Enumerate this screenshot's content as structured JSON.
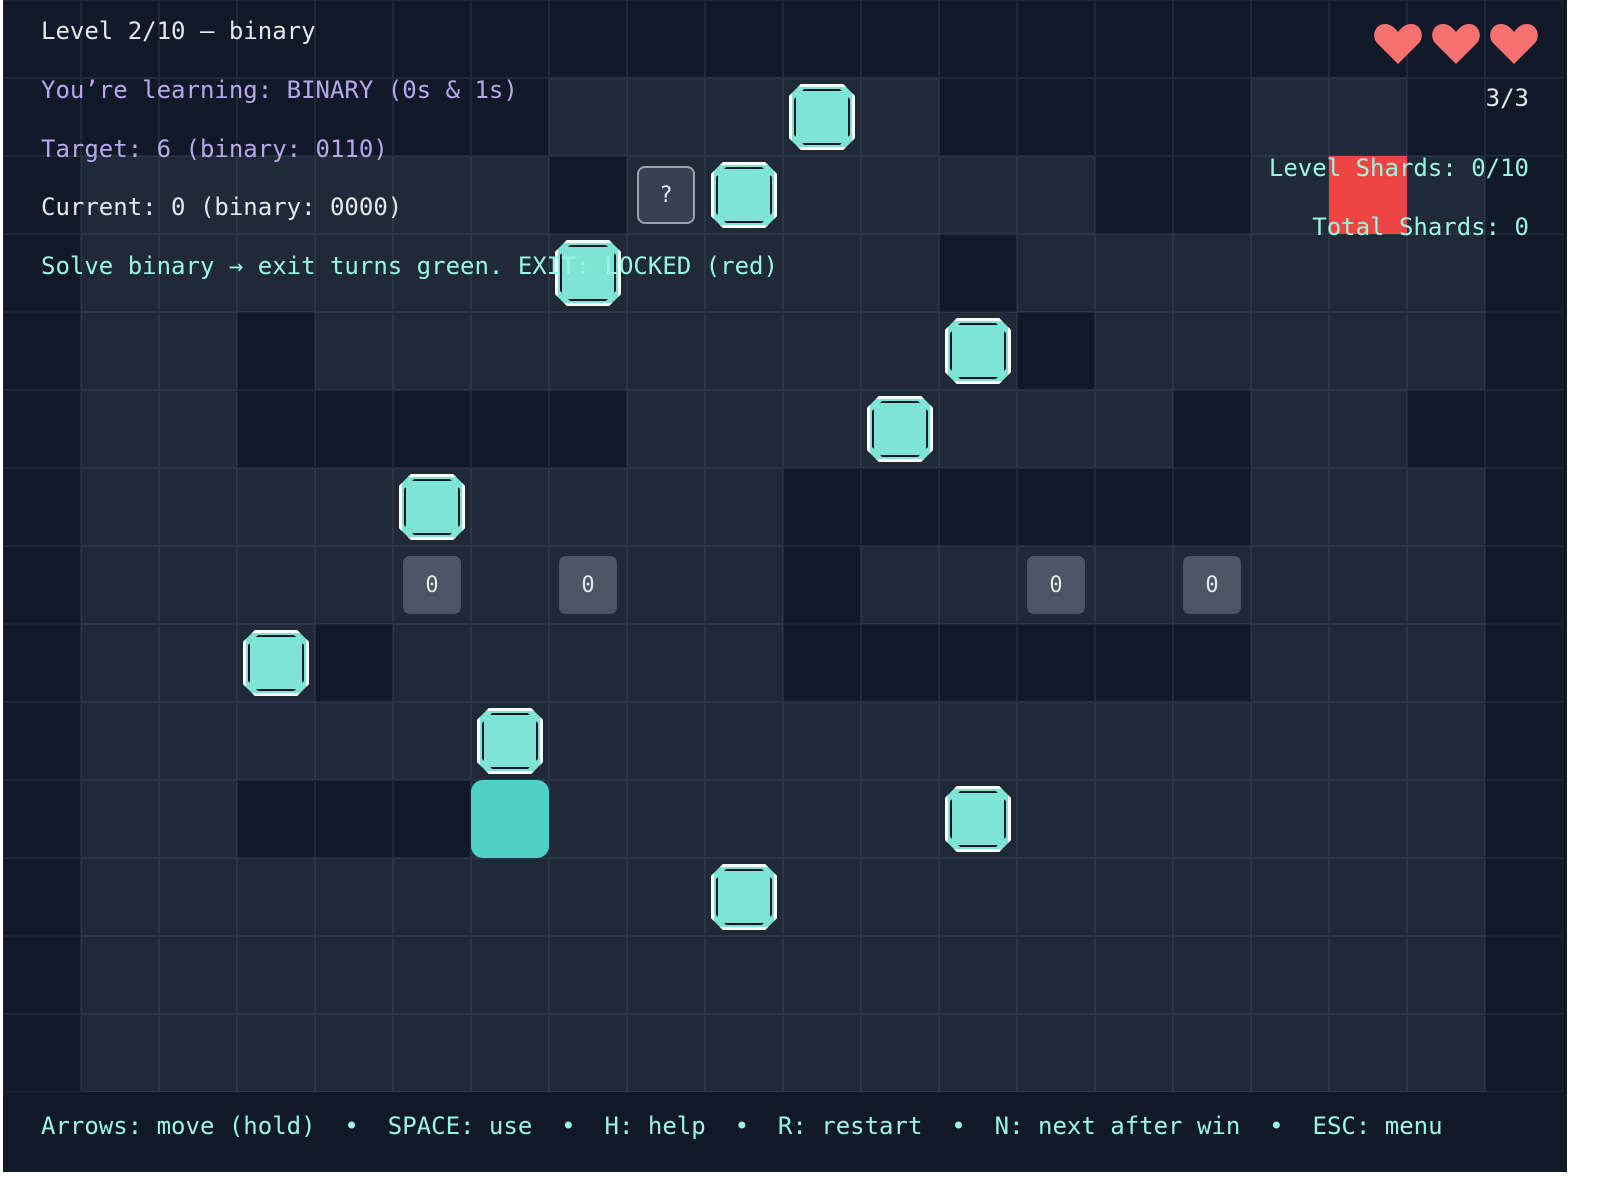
{
  "hud": {
    "level": "Level 2/10 – binary",
    "learning": "You’re learning: BINARY (0s & 1s)",
    "target": "Target: 6 (binary: 0110)",
    "current": "Current: 0 (binary: 0000)",
    "hint": "Solve binary → exit turns green. EXIT: LOCKED (red)",
    "lives_count": "3/3",
    "lives": 3,
    "level_shards": "Level Shards: 0/10",
    "total_shards": "Total Shards: 0"
  },
  "bits": [
    "0",
    "0",
    "0",
    "0"
  ],
  "help_tile": "?",
  "footer": {
    "controls": "Arrows: move (hold)  •  SPACE: use  •  H: help  •  R: restart  •  N: next after win  •  ESC: menu"
  },
  "colors": {
    "background": "#111827",
    "floor": "#1f2937",
    "wall": "#111827",
    "shard": "#7ee5d5",
    "player": "#4fd1c5",
    "exit_locked": "#ef4444",
    "heart": "#f87171",
    "hud_purple": "#b9a7ee",
    "hud_teal": "#99f6e4"
  },
  "icons": {
    "heart": "heart-icon",
    "shard": "shard-icon",
    "player": "player-icon",
    "bit_switch": "bit-switch-icon",
    "help_tile": "question-icon",
    "exit": "exit-door-icon"
  }
}
